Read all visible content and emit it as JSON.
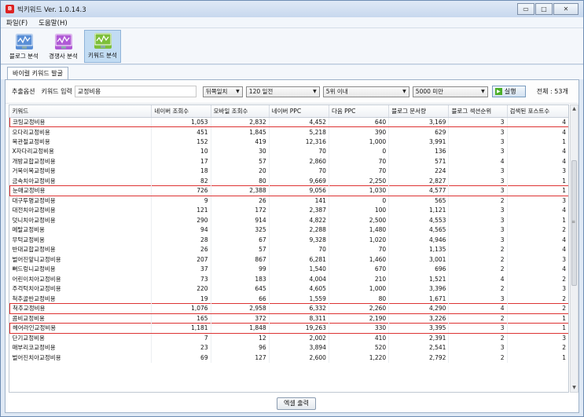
{
  "window": {
    "title": "빅키워드 Ver. 1.0.14.3",
    "app_icon": "B",
    "minimize": "▭",
    "maximize": "□",
    "close": "✕"
  },
  "menu": [
    {
      "label": "파일(F)"
    },
    {
      "label": "도움말(H)"
    }
  ],
  "toolbar": [
    {
      "label": "블로그 분석",
      "icon": "blog-chart-icon",
      "color": "#5a8fd6"
    },
    {
      "label": "경쟁사 분석",
      "icon": "competitor-chart-icon",
      "color": "#b05ad6"
    },
    {
      "label": "키워드 분석",
      "icon": "keyword-chart-icon",
      "color": "#7dbf3a",
      "active": true
    }
  ],
  "tab": "바이럴 키워드 발굴",
  "filter": {
    "options_label": "추출옵션",
    "keyword_label": "키워드 입력",
    "keyword_value": "교정비용",
    "match": "뒤쪽일치",
    "period": "120 일전",
    "rank": "5위 이내",
    "volume": "5000 미만",
    "run": "실행",
    "total": "전체 : 53개"
  },
  "columns": [
    "키워드",
    "네이버 조회수",
    "모바일 조회수",
    "네이버 PPC",
    "다음 PPC",
    "블로그 문서량",
    "블로그 섹션순위",
    "검색된 포스트수"
  ],
  "rows": [
    [
      "코팅교정비용",
      "1,053",
      "2,832",
      "4,452",
      "640",
      "3,169",
      "3",
      "4",
      true
    ],
    [
      "오다리교정비용",
      "451",
      "1,845",
      "5,218",
      "390",
      "629",
      "3",
      "4",
      false
    ],
    [
      "목관절교정비용",
      "152",
      "419",
      "12,316",
      "1,000",
      "3,991",
      "3",
      "1",
      false
    ],
    [
      "X자다리교정비용",
      "10",
      "30",
      "70",
      "0",
      "136",
      "3",
      "4",
      false
    ],
    [
      "개방교합교정비용",
      "17",
      "57",
      "2,860",
      "70",
      "571",
      "4",
      "4",
      false
    ],
    [
      "거북이목교정비용",
      "18",
      "20",
      "70",
      "70",
      "224",
      "3",
      "3",
      false
    ],
    [
      "금속치아교정비용",
      "82",
      "80",
      "9,669",
      "2,250",
      "2,827",
      "3",
      "1",
      false
    ],
    [
      "눈매교정비용",
      "726",
      "2,388",
      "9,056",
      "1,030",
      "4,577",
      "3",
      "1",
      true
    ],
    [
      "대구투명교정비용",
      "9",
      "26",
      "141",
      "0",
      "565",
      "2",
      "3",
      false
    ],
    [
      "대전치아교정비용",
      "121",
      "172",
      "2,387",
      "100",
      "1,121",
      "3",
      "4",
      false
    ],
    [
      "덧니치아교정비용",
      "290",
      "914",
      "4,822",
      "2,500",
      "4,553",
      "3",
      "1",
      false
    ],
    [
      "메탈교정비용",
      "94",
      "325",
      "2,288",
      "1,480",
      "4,565",
      "3",
      "2",
      false
    ],
    [
      "무턱교정비용",
      "28",
      "67",
      "9,328",
      "1,020",
      "4,946",
      "3",
      "4",
      false
    ],
    [
      "반대교합교정비용",
      "26",
      "57",
      "70",
      "70",
      "1,135",
      "2",
      "4",
      false
    ],
    [
      "벌어진앞니교정비용",
      "207",
      "867",
      "6,281",
      "1,460",
      "3,001",
      "2",
      "3",
      false
    ],
    [
      "뻐드렁니교정비용",
      "37",
      "99",
      "1,540",
      "670",
      "696",
      "2",
      "4",
      false
    ],
    [
      "어린이치아교정비용",
      "73",
      "183",
      "4,004",
      "210",
      "1,521",
      "4",
      "2",
      false
    ],
    [
      "주걱턱치아교정비용",
      "220",
      "645",
      "4,605",
      "1,000",
      "3,396",
      "2",
      "3",
      false
    ],
    [
      "척추골반교정비용",
      "19",
      "66",
      "1,559",
      "80",
      "1,671",
      "3",
      "2",
      false
    ],
    [
      "척추교정비용",
      "1,076",
      "2,958",
      "6,332",
      "2,260",
      "4,290",
      "4",
      "2",
      true
    ],
    [
      "콤비교정비용",
      "165",
      "372",
      "8,311",
      "2,190",
      "3,226",
      "2",
      "1",
      false
    ],
    [
      "헤어라인교정비용",
      "1,181",
      "1,848",
      "19,263",
      "330",
      "3,395",
      "3",
      "1",
      true
    ],
    [
      "단기교정비용",
      "7",
      "12",
      "2,002",
      "410",
      "2,391",
      "2",
      "3",
      false
    ],
    [
      "매부리코교정비용",
      "23",
      "96",
      "3,894",
      "520",
      "2,541",
      "3",
      "2",
      false
    ],
    [
      "벌어진치아교정비용",
      "69",
      "127",
      "2,600",
      "1,220",
      "2,792",
      "2",
      "1",
      false
    ]
  ],
  "scroll_icons": {
    "up": "▲",
    "down": "▼",
    "grip": "≡"
  },
  "excel": "엑셀 출력"
}
